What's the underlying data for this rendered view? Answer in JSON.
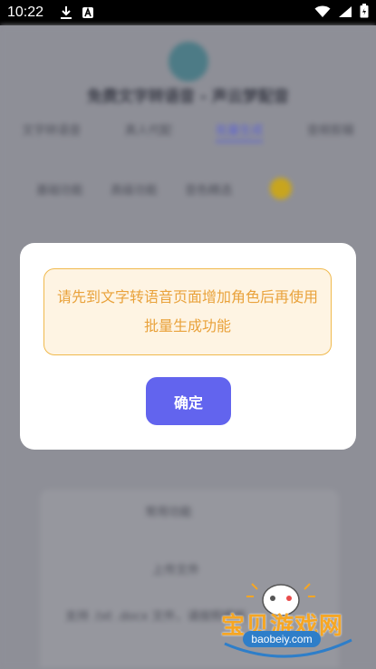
{
  "status_bar": {
    "time": "10:22",
    "icons": [
      "download-icon",
      "a-box-icon",
      "wifi-icon",
      "signal-icon",
      "battery-icon"
    ]
  },
  "background": {
    "title": "免费文字转语音 - 声云梦配音",
    "tabs": [
      {
        "label": "文字转语音"
      },
      {
        "label": "真人代配"
      },
      {
        "label": "批量生成"
      },
      {
        "label": "音频剪辑"
      }
    ],
    "subtabs": [
      {
        "label": "基础功能"
      },
      {
        "label": "高级功能"
      },
      {
        "label": "音色精选"
      }
    ],
    "lower_item_1": "常用功能",
    "lower_item_2": "上传文件",
    "lower_text": "支持 .txt .docx 文件，请按照模板"
  },
  "dialog": {
    "message": "请先到文字转语音页面增加角色后再使用批量生成功能",
    "confirm_label": "确定",
    "colors": {
      "notice_bg": "#fef4e3",
      "notice_border": "#f0b94d",
      "notice_text": "#e9a23b",
      "button_bg": "#6264ee"
    }
  },
  "watermark": {
    "name": "宝贝游戏网",
    "url": "baobeiy.com"
  }
}
